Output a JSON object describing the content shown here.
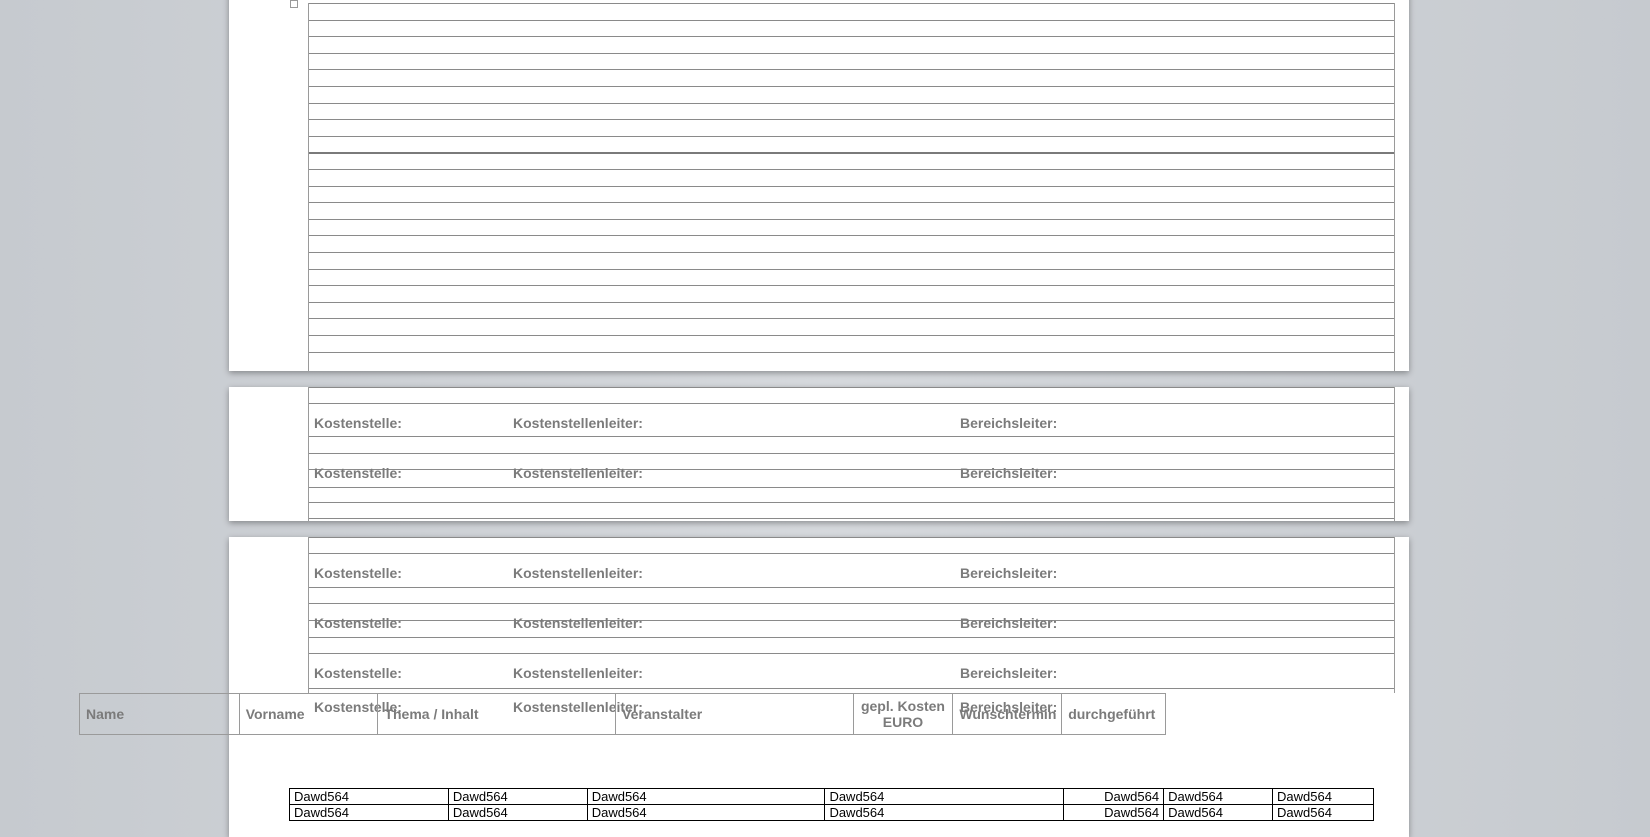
{
  "labels": {
    "kostenstelle": "Kostenstelle:",
    "kostenstellenleiter": "Kostenstellenleiter:",
    "bereichsleiter": "Bereichsleiter:"
  },
  "header_row": [
    "Name",
    "Vorname",
    "Thema / Inhalt",
    "Veranstalter",
    "gepl. Kosten EURO",
    "Wunschtermin",
    "durchgeführt"
  ],
  "data_rows": [
    [
      "Dawd564",
      "Dawd564",
      "Dawd564",
      "Dawd564",
      "Dawd564",
      "Dawd564",
      "Dawd564"
    ],
    [
      "Dawd564",
      "Dawd564",
      "Dawd564",
      "Dawd564",
      "Dawd564",
      "Dawd564",
      "Dawd564"
    ]
  ]
}
